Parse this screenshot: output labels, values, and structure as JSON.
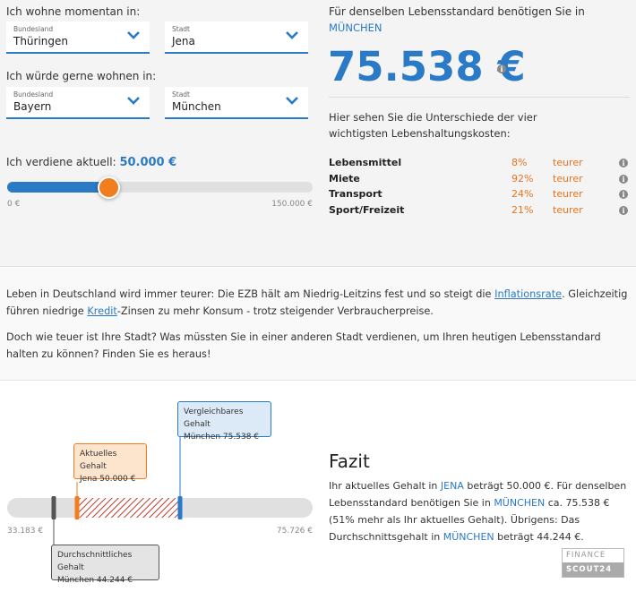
{
  "current": {
    "label": "Ich wohne momentan in:",
    "state_caption": "Bundesland",
    "state_value": "Thüringen",
    "city_caption": "Stadt",
    "city_value": "Jena"
  },
  "desired": {
    "label": "Ich würde gerne wohnen in:",
    "state_caption": "Bundesland",
    "state_value": "Bayern",
    "city_caption": "Stadt",
    "city_value": "München"
  },
  "salary": {
    "label": "Ich verdiene aktuell:",
    "value": "50.000 €",
    "min_label": "0 €",
    "max_label": "150.000 €",
    "fraction": 0.333
  },
  "result": {
    "intro": "Für denselben Lebensstandard benötigen Sie in",
    "city": "MÜNCHEN",
    "amount": "75.538 €",
    "costs_intro": "Hier sehen Sie die Unterschiede der vier wichtigsten Lebenshaltungskosten:",
    "costs": [
      {
        "name": "Lebensmittel",
        "percent": "8%",
        "trend": "teurer"
      },
      {
        "name": "Miete",
        "percent": "92%",
        "trend": "teurer"
      },
      {
        "name": "Transport",
        "percent": "24%",
        "trend": "teurer"
      },
      {
        "name": "Sport/Freizeit",
        "percent": "21%",
        "trend": "teurer"
      }
    ]
  },
  "article": {
    "p1_a": "Leben in Deutschland wird immer teurer: Die EZB hält am Niedrig-Leitzins fest und so steigt die ",
    "p1_link1": "Inflationsrate",
    "p1_b": ". Gleichzeitig führen niedrige ",
    "p1_link2": "Kredit",
    "p1_c": "-Zinsen zu mehr Konsum - trotz steigender Verbraucherpreise.",
    "p2": "Doch wie teuer ist Ihre Stadt? Was müssten Sie in einer anderen Stadt verdienen, um Ihren heutigen Lebensstandard halten zu können? Finden Sie es heraus!"
  },
  "comparison": {
    "range_min_label": "33.183 €",
    "range_max_label": "75.726 €",
    "range_min": 33183,
    "range_max": 75726,
    "current_value": 50000,
    "comparable_value": 75538,
    "average_value": 44244,
    "current_box": {
      "title": "Aktuelles Gehalt",
      "text": "Jena 50.000 €"
    },
    "comparable_box": {
      "title": "Vergleichbares Gehalt",
      "text": "München 75.538 €"
    },
    "average_box": {
      "title": "Durchschnittliches Gehalt",
      "text": "München 44.244 €"
    }
  },
  "fazit": {
    "title": "Fazit",
    "t1": "Ihr aktuelles Gehalt in ",
    "city1": "JENA",
    "t2": " beträgt 50.000 €. Für denselben Lebensstandard benötigen Sie in ",
    "city2": "MÜNCHEN",
    "t3": " ca. 75.538 € (51% mehr als Ihr aktuelles Gehalt). Übrigens: Das Durchschnittsgehalt in ",
    "city3": "MÜNCHEN",
    "t4": " beträgt 44.244 €."
  },
  "logo": {
    "line1": "FINANCE",
    "line2": "SCOUT24"
  },
  "colors": {
    "accent": "#2a7ac6",
    "orange": "#f07d1e",
    "track": "#e0e0e0"
  }
}
